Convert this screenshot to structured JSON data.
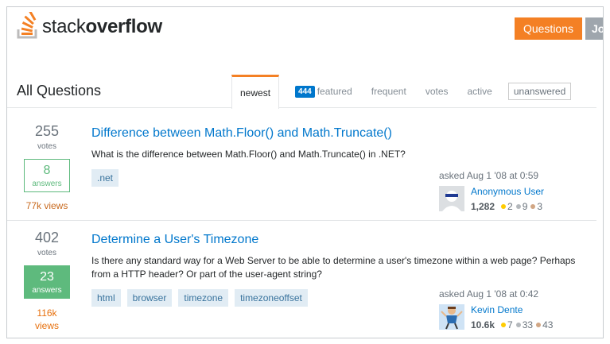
{
  "header": {
    "logo_text_light": "stack",
    "logo_text_bold": "overflow",
    "questions_button": "Questions",
    "jobs_button_partial": "Jo"
  },
  "subheader": {
    "title": "All Questions",
    "tabs": [
      {
        "label": "newest",
        "active": true
      },
      {
        "label": "featured",
        "badge": "444"
      },
      {
        "label": "frequent"
      },
      {
        "label": "votes"
      },
      {
        "label": "active"
      },
      {
        "label": "unanswered"
      }
    ]
  },
  "questions": [
    {
      "votes": "255",
      "votes_label": "votes",
      "answers": "8",
      "answers_label": "answers",
      "views": "77k views",
      "title": "Difference between Math.Floor() and Math.Truncate()",
      "excerpt": "What is the difference between Math.Floor() and Math.Truncate() in .NET?",
      "tags": [
        ".net"
      ],
      "asked": "asked Aug 1 '08 at 0:59",
      "user": {
        "name": "Anonymous User",
        "rep": "1,282",
        "gold": "2",
        "silver": "9",
        "bronze": "3"
      }
    },
    {
      "votes": "402",
      "votes_label": "votes",
      "answers": "23",
      "answers_label": "answers",
      "views_number": "116k",
      "views_label": "views",
      "title": "Determine a User's Timezone",
      "excerpt": "Is there any standard way for a Web Server to be able to determine a user's timezone within a web page? Perhaps from a HTTP header? Or part of the user-agent string?",
      "tags": [
        "html",
        "browser",
        "timezone",
        "timezoneoffset"
      ],
      "asked": "asked Aug 1 '08 at 0:42",
      "user": {
        "name": "Kevin Dente",
        "rep": "10.6k",
        "gold": "7",
        "silver": "33",
        "bronze": "43"
      }
    }
  ],
  "colors": {
    "brand_orange": "#f48024",
    "link_blue": "#0077cc",
    "accepted_green": "#5eba7d",
    "tag_bg": "#e1ecf4",
    "gold": "#ffcc01",
    "silver": "#b4b8bc",
    "bronze": "#d1a684"
  },
  "icons": {
    "logo": "stack-overflow-logo-icon",
    "avatar_1": "anonymous-user-avatar",
    "avatar_2": "kevin-dente-avatar"
  }
}
